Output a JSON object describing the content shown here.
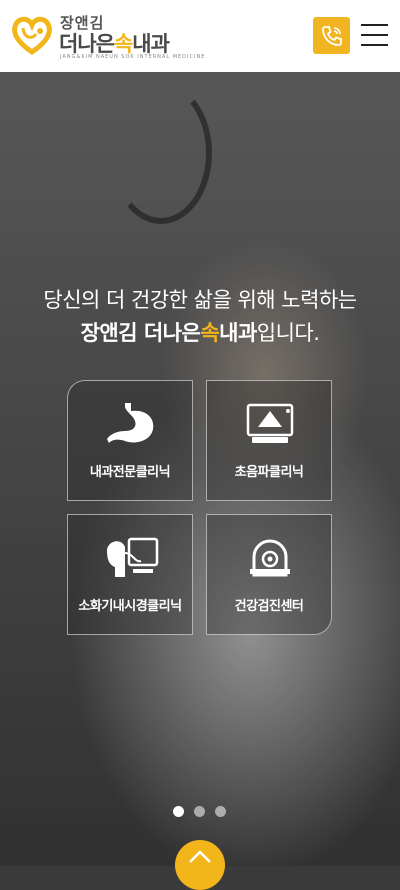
{
  "header": {
    "logo_small": "장앤김",
    "logo_big_prefix": "더나은",
    "logo_big_accent": "속",
    "logo_big_suffix": "내과",
    "logo_tagline": "JANG&KIM NAEUN SOK INTERNAL MEDICINE",
    "phone_icon": "phone-icon",
    "menu_icon": "hamburger-menu-icon"
  },
  "hero": {
    "line1": "당신의 더 건강한 삶을 위해 노력하는",
    "line2_name": "장앤김 더나은",
    "line2_accent": "속",
    "line2_name_end": "내과",
    "line2_suffix": "입니다."
  },
  "cards": [
    {
      "label": "내과전문클리닉",
      "icon": "stomach-icon"
    },
    {
      "label": "초음파클리닉",
      "icon": "ultrasound-icon"
    },
    {
      "label": "소화기내시경클리닉",
      "icon": "endoscopy-icon"
    },
    {
      "label": "건강검진센터",
      "icon": "ct-scanner-icon"
    }
  ],
  "slider": {
    "count": 3,
    "active": 1
  },
  "colors": {
    "accent": "#f3b61a",
    "header_bg": "#ffffff",
    "text_dark": "#4a4a4a"
  }
}
